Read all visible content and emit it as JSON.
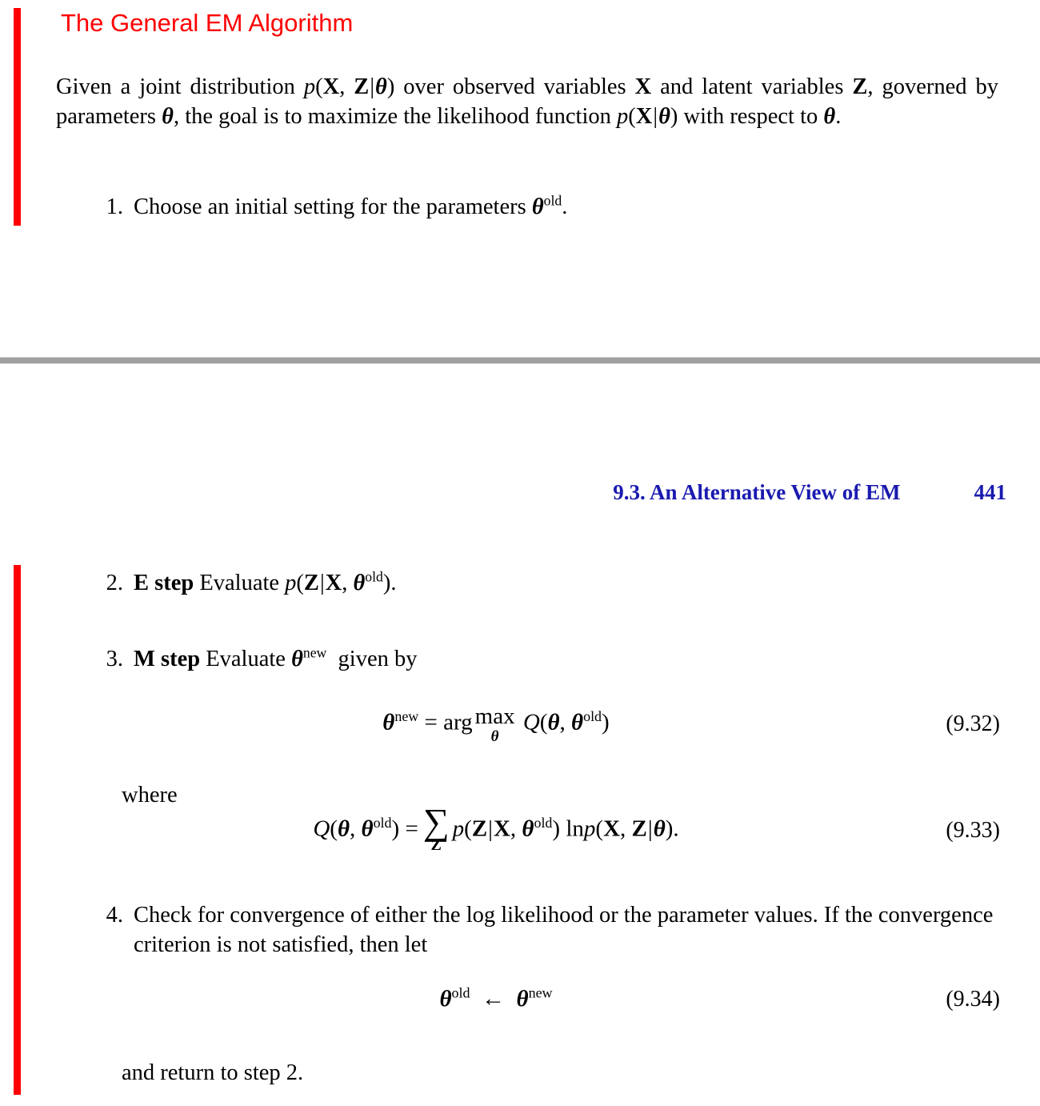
{
  "slide": {
    "title": "The General EM Algorithm",
    "title_color": "#ff0000",
    "accent_bar_color": "#ff0000"
  },
  "intro": {
    "text": "Given a joint distribution p(X, Z|θ) over observed variables X and latent variables Z, governed by parameters θ, the goal is to maximize the likelihood function p(X|θ) with respect to θ."
  },
  "running_header": {
    "section_title": "9.3. An Alternative View of EM",
    "page_number": "441",
    "color": "#1a1ab0"
  },
  "separator": {
    "color": "#a0a0a0"
  },
  "steps": [
    {
      "number": "1.",
      "label": "",
      "text": "Choose an initial setting for the parameters θold."
    },
    {
      "number": "2.",
      "label": "E step",
      "text": "Evaluate p(Z|X, θold)."
    },
    {
      "number": "3.",
      "label": "M step",
      "text": "Evaluate θnew given by"
    },
    {
      "number": "4.",
      "label": "",
      "text": "Check for convergence of either the log likelihood or the parameter values. If the convergence criterion is not satisfied, then let"
    }
  ],
  "connectors": {
    "where": "where",
    "return": "and return to step 2."
  },
  "equations": [
    {
      "tag": "(9.32)",
      "latex": "\\boldsymbol{\\theta}^{\\mathrm{new}} = \\arg\\max_{\\boldsymbol{\\theta}} \\mathcal{Q}(\\boldsymbol{\\theta}, \\boldsymbol{\\theta}^{\\mathrm{old}})",
      "plain": "θnew = arg maxθ Q(θ, θold)"
    },
    {
      "tag": "(9.33)",
      "latex": "\\mathcal{Q}(\\boldsymbol{\\theta}, \\boldsymbol{\\theta}^{\\mathrm{old}}) = \\sum_{\\mathbf{Z}} p(\\mathbf{Z}|\\mathbf{X}, \\boldsymbol{\\theta}^{\\mathrm{old}}) \\ln p(\\mathbf{X}, \\mathbf{Z}|\\boldsymbol{\\theta}).",
      "plain": "Q(θ, θold) = ΣZ p(Z|X, θold) ln p(X, Z|θ)."
    },
    {
      "tag": "(9.34)",
      "latex": "\\boldsymbol{\\theta}^{\\mathrm{old}} \\leftarrow \\boldsymbol{\\theta}^{\\mathrm{new}}",
      "plain": "θold ← θnew"
    }
  ],
  "symbols": {
    "theta": "θ",
    "sup_old": "old",
    "sup_new": "new",
    "sum": "∑",
    "leftarrow": "←",
    "script_q": "𝑄",
    "ln": "ln",
    "arg": "arg",
    "max": "max",
    "p": "p",
    "X": "X",
    "Z": "Z",
    "bar": "|",
    "comma": ",",
    "period": ".",
    "lparen": "(",
    "rparen": ")",
    "equals": "="
  }
}
